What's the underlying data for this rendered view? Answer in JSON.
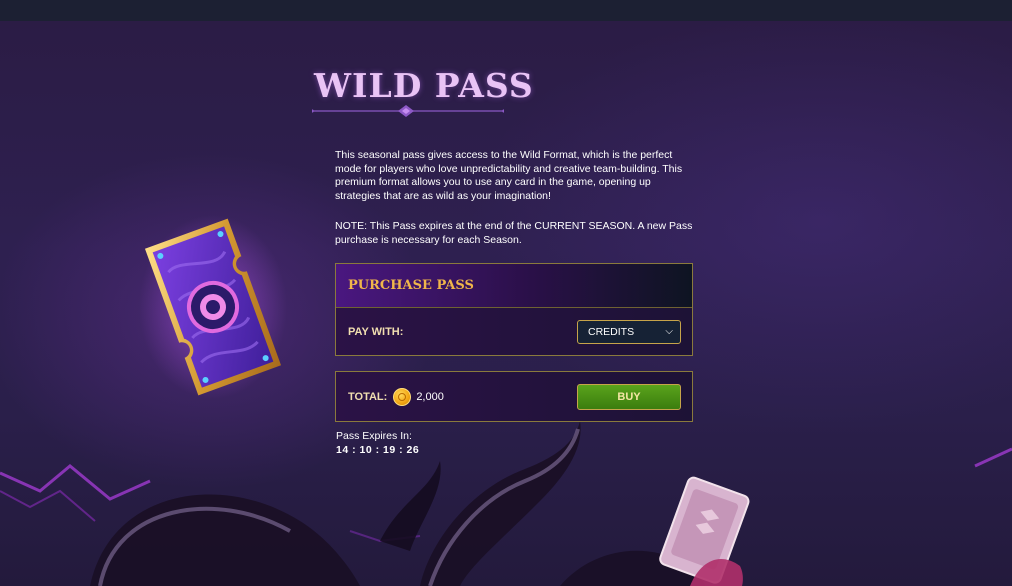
{
  "page": {
    "title": "WILD PASS",
    "description": "This seasonal pass gives access to the Wild Format, which is the perfect mode for players who love unpredictability and creative team-building. This premium format allows you to use any card in the game, opening up strategies that are as wild as your imagination!",
    "note": "NOTE: This Pass expires at the end of the CURRENT SEASON. A new Pass purchase is necessary for each Season."
  },
  "purchase": {
    "header": "PURCHASE PASS",
    "pay_with_label": "PAY WITH:",
    "payment_method": "CREDITS",
    "payment_icon": "chevron-down-icon"
  },
  "total": {
    "label": "TOTAL:",
    "currency_icon": "credit-coin-icon",
    "amount": "2,000",
    "buy_label": "BUY"
  },
  "expiry": {
    "label": "Pass Expires In:",
    "countdown": "14 : 10 : 19 : 26"
  },
  "colors": {
    "title": "#e9c3f5",
    "header_text": "#f0b64a",
    "border_gold": "#c6a44a",
    "buy_green": "#4a9317"
  }
}
